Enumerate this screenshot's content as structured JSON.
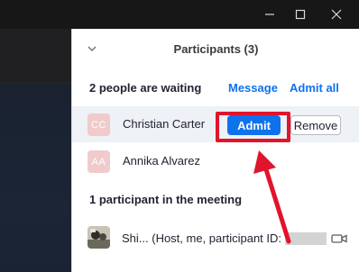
{
  "window": {
    "minimize_icon": "minimize-icon",
    "maximize_icon": "maximize-icon",
    "close_icon": "close-icon"
  },
  "panel": {
    "title": "Participants (3)",
    "collapse_icon": "chevron-down-icon"
  },
  "waiting": {
    "title": "2 people are waiting",
    "message_label": "Message",
    "admit_all_label": "Admit all",
    "people": [
      {
        "initials": "CC",
        "name": "Christian Carter",
        "admit_label": "Admit",
        "remove_label": "Remove"
      },
      {
        "initials": "AA",
        "name": "Annika Alvarez"
      }
    ]
  },
  "meeting": {
    "title": "1 participant in the meeting",
    "host": {
      "name": "Shi... (Host, me, participant ID:"
    }
  },
  "colors": {
    "accent": "#0e72ed",
    "highlight": "#e0142c",
    "avatar_bg": "#f1cbcb"
  }
}
